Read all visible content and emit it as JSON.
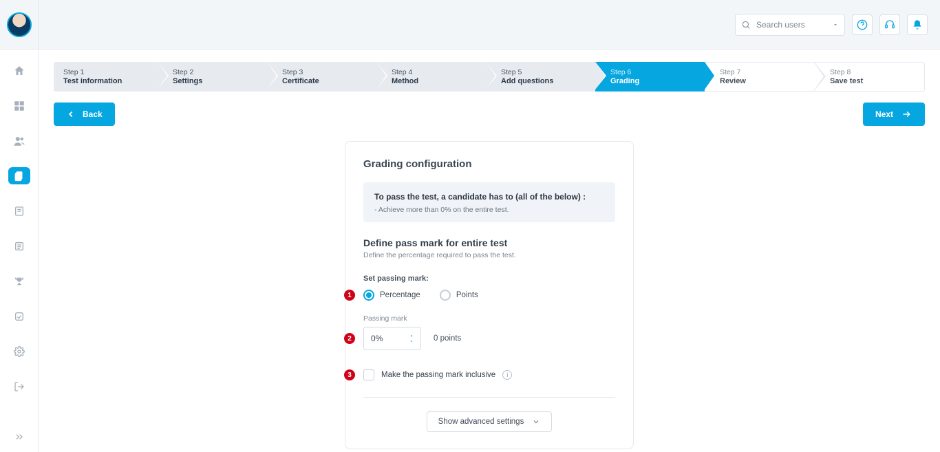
{
  "header": {
    "search_placeholder": "Search users"
  },
  "stepper": [
    {
      "step": "Step 1",
      "name": "Test information",
      "state": "past"
    },
    {
      "step": "Step 2",
      "name": "Settings",
      "state": "past"
    },
    {
      "step": "Step 3",
      "name": "Certificate",
      "state": "past"
    },
    {
      "step": "Step 4",
      "name": "Method",
      "state": "past"
    },
    {
      "step": "Step 5",
      "name": "Add questions",
      "state": "past"
    },
    {
      "step": "Step 6",
      "name": "Grading",
      "state": "active"
    },
    {
      "step": "Step 7",
      "name": "Review",
      "state": "future"
    },
    {
      "step": "Step 8",
      "name": "Save test",
      "state": "future"
    }
  ],
  "nav": {
    "back": "Back",
    "next": "Next"
  },
  "card": {
    "title": "Grading configuration",
    "infobox_headline": "To pass the test, a candidate has to (all of the below) :",
    "infobox_bullet": "- Achieve more than 0% on the entire test.",
    "section_title": "Define pass mark for entire test",
    "section_sub": "Define the percentage required to pass the test.",
    "set_passing_label": "Set passing mark:",
    "radio_percentage": "Percentage",
    "radio_points": "Points",
    "passing_mark_label": "Passing mark",
    "passing_mark_value": "0%",
    "points_text": "0 points",
    "checkbox_label": "Make the passing mark inclusive",
    "advanced_label": "Show advanced settings"
  },
  "annotations": {
    "b1": "1",
    "b2": "2",
    "b3": "3"
  }
}
